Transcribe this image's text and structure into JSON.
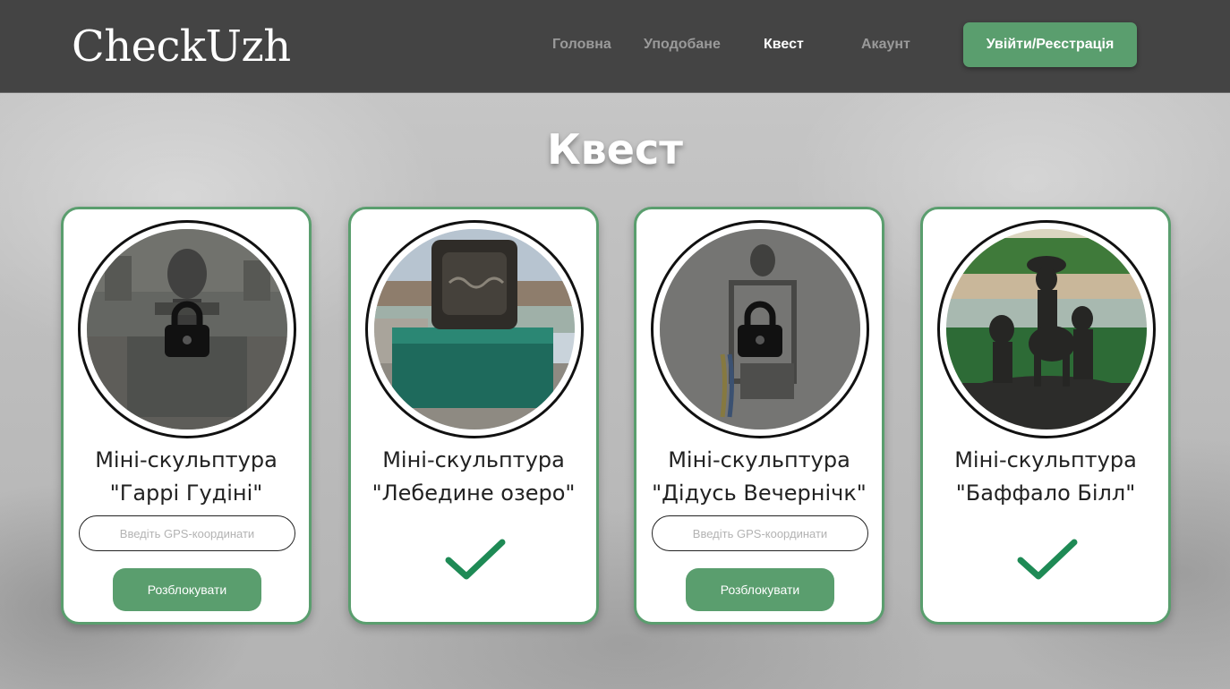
{
  "header": {
    "logo": "CheckUzh",
    "nav": [
      {
        "label": "Головна",
        "active": false
      },
      {
        "label": "Уподобане",
        "active": false
      },
      {
        "label": "Квест",
        "active": true
      },
      {
        "label": "Акаунт",
        "active": false
      }
    ],
    "login_label": "Увійти/Реєстрація"
  },
  "page": {
    "title": "Квест"
  },
  "cards": [
    {
      "title_line1": "Міні-скульптура",
      "title_line2": "\"Гаррі Гудіні\"",
      "status": "locked",
      "icon": "lock-icon",
      "gps_placeholder": "Введіть GPS-координати",
      "unlock_label": "Розблокувати"
    },
    {
      "title_line1": "Міні-скульптура",
      "title_line2": "\"Лебедине озеро\"",
      "status": "unlocked",
      "icon": "checkmark-icon"
    },
    {
      "title_line1": "Міні-скульптура",
      "title_line2": "\"Дідусь Вечернічк\"",
      "status": "locked",
      "icon": "lock-icon",
      "gps_placeholder": "Введіть GPS-координати",
      "unlock_label": "Розблокувати"
    },
    {
      "title_line1": "Міні-скульптура",
      "title_line2": "\"Баффало Білл\"",
      "status": "unlocked",
      "icon": "checkmark-icon"
    }
  ],
  "colors": {
    "header_bg": "#444444",
    "accent_green": "#5a9e6e",
    "check_green": "#1e8a55",
    "card_border": "#5a9e6e"
  }
}
